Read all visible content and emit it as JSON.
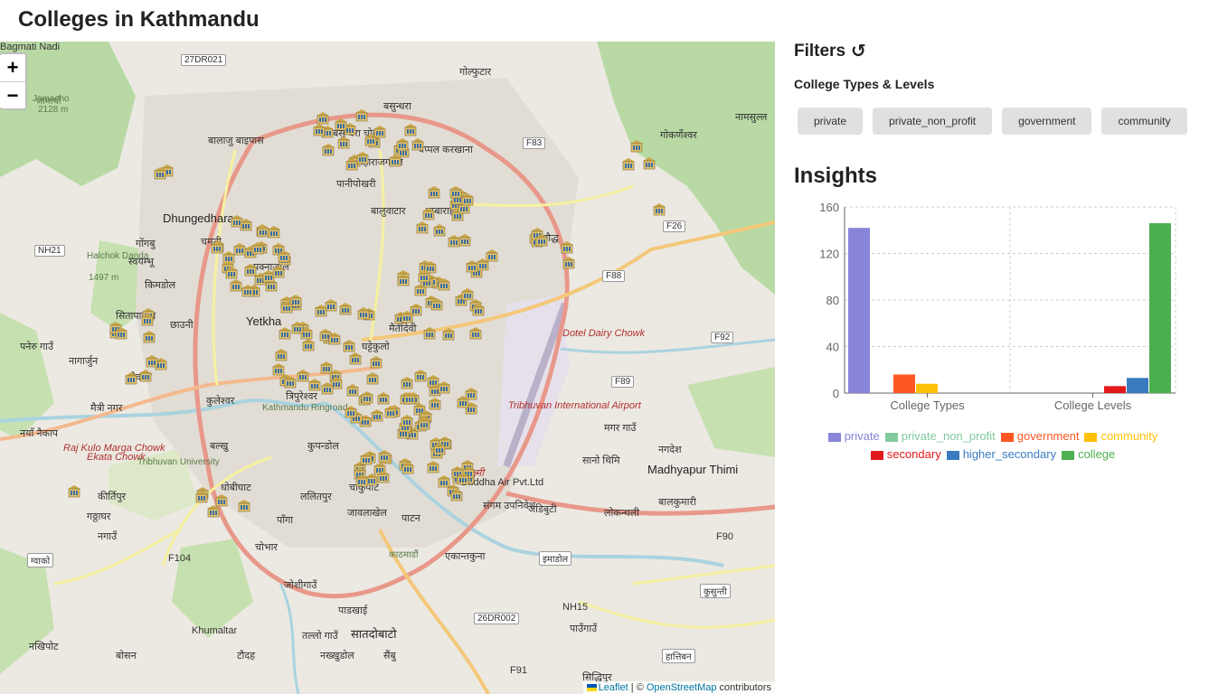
{
  "page": {
    "title": "Colleges in Kathmandu"
  },
  "map": {
    "zoom_in": "+",
    "zoom_out": "−",
    "attribution": {
      "leaflet": "Leaflet",
      "sep": " | © ",
      "osm": "OpenStreetMap",
      "suffix": " contributors"
    },
    "labels": [
      "27DR021",
      "जामाचो",
      "Jamacho",
      "2128 m",
      "गोल्फुटार",
      "बसुन्धरा",
      "बालाजु बाइपास",
      "बसुन्धरा चोकी",
      "महाराजगञ्ज",
      "चप्पल करखाना",
      "पानीपोखरी",
      "F83",
      "गोकर्णेश्वर",
      "नामसुल्ल",
      "Dhungedhara",
      "बालुवाटार",
      "धुम्बाराही",
      "चमती",
      "NH21",
      "Halchok Danda",
      "1497 m",
      "स्वयम्भू",
      "गोंगबु",
      "पक्नाजोल",
      "F26",
      "बौद्ध",
      "F88",
      "किमडोल",
      "सितापाइला",
      "छाउनी",
      "Yetkha",
      "मैतीदेवी",
      "पनेरु गाउँ",
      "नागार्जुन",
      "Dotel Dairy Chowk",
      "F92",
      "घट्टेकुलो",
      "नैकाप",
      "कुलेश्वर",
      "त्रिपुरेश्वर",
      "F89",
      "मैत्री नगर",
      "Tribhuvan International Airport",
      "नयाँ नैकाप",
      "Raj Kulo Marga Chowk",
      "Ekata Chowk",
      "Tribhuvan University",
      "कुपन्डोल",
      "बल्खु",
      "मगर गाउँ",
      "नगदेश",
      "सानो थिमि",
      "Madhyapur Thimi",
      "कीर्तिपुर",
      "धोबीघाट",
      "ललितपुर",
      "चाकुपाट",
      "बालकुमारी",
      "संगम उपनिवेश",
      "जडिबुटी",
      "लोकन्थली",
      "गठ्ठाघर",
      "नगाउँ",
      "पाँगा",
      "जावलाखेल",
      "पाटन",
      "ग्वाको",
      "F104",
      "चोभार",
      "एकान्तकुना",
      "इमाडोल",
      "F90",
      "जोशीगाउँ",
      "कुसुन्ती",
      "26DR002",
      "NH15",
      "पाउँगाउँ",
      "पाडखाई",
      "सातदोबाटो",
      "Khumaltar",
      "तल्लो गाउँ",
      "नख्खुडोल",
      "नखिपोट",
      "बोसन",
      "टौदह",
      "सैंबु",
      "हात्तिबन",
      "F91",
      "सिद्धिपुर",
      "महालक्ष्मी",
      "Buddha Air Pvt.Ltd",
      "काठमाडौं",
      "Kathmandu Ringroad",
      "Bagmati Nadi"
    ]
  },
  "sidebar": {
    "filters_title": "Filters",
    "reset_icon": "refresh-icon",
    "section_title": "College Types & Levels",
    "chips": [
      "private",
      "private_non_profit",
      "government",
      "community"
    ],
    "insights_title": "Insights"
  },
  "chart_data": {
    "type": "bar",
    "categories": [
      "College Types",
      "College Levels"
    ],
    "ylim": [
      0,
      160
    ],
    "yticks": [
      0,
      40,
      80,
      120,
      160
    ],
    "grid": true,
    "legend_position": "bottom",
    "series": [
      {
        "name": "private",
        "color": "#8884d8",
        "values": [
          142,
          null
        ]
      },
      {
        "name": "private_non_profit",
        "color": "#82ca9d",
        "values": [
          null,
          null
        ]
      },
      {
        "name": "government",
        "color": "#ff5722",
        "values": [
          16,
          null
        ]
      },
      {
        "name": "community",
        "color": "#ffc107",
        "values": [
          8,
          null
        ]
      },
      {
        "name": "secondary",
        "color": "#e31a1c",
        "values": [
          null,
          6
        ]
      },
      {
        "name": "higher_secondary",
        "color": "#3a7bbf",
        "values": [
          null,
          13
        ]
      },
      {
        "name": "college",
        "color": "#4caf50",
        "values": [
          null,
          146
        ]
      }
    ]
  }
}
